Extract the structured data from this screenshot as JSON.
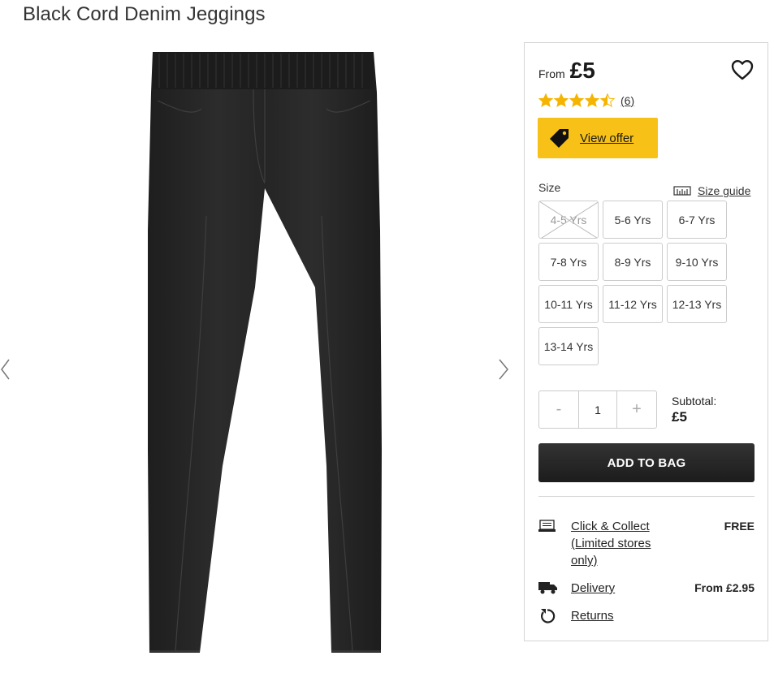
{
  "product": {
    "title": "Black Cord Denim Jeggings"
  },
  "gallery": {
    "prev_icon": "chevron-left-icon",
    "next_icon": "chevron-right-icon"
  },
  "price": {
    "from_label": "From",
    "value": "£5"
  },
  "rating": {
    "stars": 4.5,
    "max": 5,
    "count_text": "(6)",
    "star_color": "#f5b400"
  },
  "offer": {
    "label": "View offer",
    "color": "#f7c117"
  },
  "size": {
    "label": "Size",
    "guide_label": "Size guide",
    "options": [
      {
        "label": "4-5 Yrs",
        "available": false
      },
      {
        "label": "5-6 Yrs",
        "available": true
      },
      {
        "label": "6-7 Yrs",
        "available": true
      },
      {
        "label": "7-8 Yrs",
        "available": true
      },
      {
        "label": "8-9 Yrs",
        "available": true
      },
      {
        "label": "9-10 Yrs",
        "available": true
      },
      {
        "label": "10-11 Yrs",
        "available": true
      },
      {
        "label": "11-12 Yrs",
        "available": true
      },
      {
        "label": "12-13 Yrs",
        "available": true
      },
      {
        "label": "13-14 Yrs",
        "available": true
      }
    ]
  },
  "quantity": {
    "minus": "-",
    "value": "1",
    "plus": "+"
  },
  "subtotal": {
    "label": "Subtotal:",
    "value": "£5"
  },
  "add_to_bag": {
    "label": "ADD TO BAG"
  },
  "delivery": {
    "click_collect_line1": "Click & Collect",
    "click_collect_line2": "(Limited stores",
    "click_collect_line3": "only)",
    "click_collect_price": "FREE",
    "delivery_label": "Delivery",
    "delivery_price": "From £2.95",
    "returns_label": "Returns"
  }
}
